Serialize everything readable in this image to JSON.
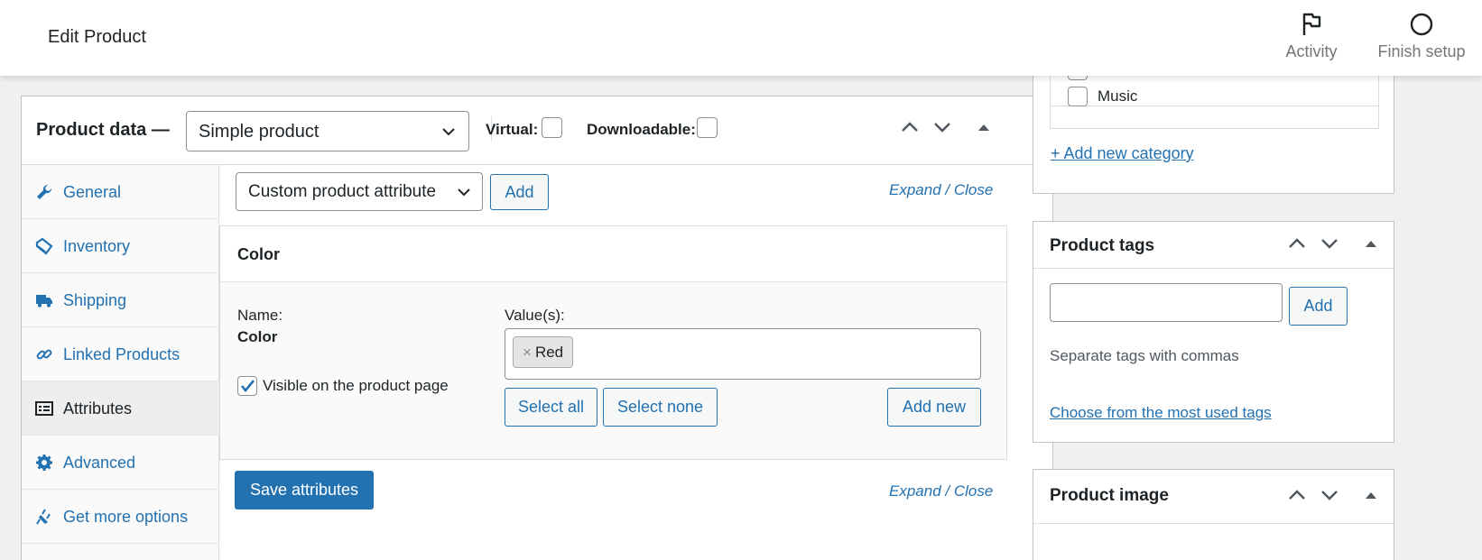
{
  "header": {
    "title": "Edit Product",
    "activity_label": "Activity",
    "finish_label": "Finish setup"
  },
  "product_data": {
    "label": "Product data —",
    "type_selected": "Simple product",
    "virtual_label": "Virtual:",
    "downloadable_label": "Downloadable:",
    "virtual_checked": false,
    "downloadable_checked": false
  },
  "tabs": [
    {
      "label": "General",
      "icon": "wrench-icon"
    },
    {
      "label": "Inventory",
      "icon": "tag-icon"
    },
    {
      "label": "Shipping",
      "icon": "truck-icon"
    },
    {
      "label": "Linked Products",
      "icon": "link-icon"
    },
    {
      "label": "Attributes",
      "icon": "list-icon",
      "active": true
    },
    {
      "label": "Advanced",
      "icon": "gear-icon"
    },
    {
      "label": "Get more options",
      "icon": "plug-icon"
    }
  ],
  "attributes_panel": {
    "attribute_select": "Custom product attribute",
    "add_label": "Add",
    "expand_close_top": "Expand / Close",
    "attribute": {
      "heading": "Color",
      "name_label": "Name:",
      "name_value": "Color",
      "values_label": "Value(s):",
      "values": [
        "Red"
      ],
      "chip_remove": "×",
      "visible_label": "Visible on the product page",
      "visible_checked": true,
      "select_all": "Select all",
      "select_none": "Select none",
      "add_new": "Add new"
    },
    "save_label": "Save attributes",
    "expand_close_bottom": "Expand / Close"
  },
  "sidebar": {
    "categories": {
      "items": [
        "Music"
      ],
      "add_new_link": "+ Add new category"
    },
    "tags": {
      "title": "Product tags",
      "input_value": "",
      "add_label": "Add",
      "hint": "Separate tags with commas",
      "choose_link": "Choose from the most used tags"
    },
    "image": {
      "title": "Product image"
    }
  },
  "colors": {
    "accent": "#2271b1",
    "text": "#1d2327",
    "background": "#f0f0f1"
  }
}
